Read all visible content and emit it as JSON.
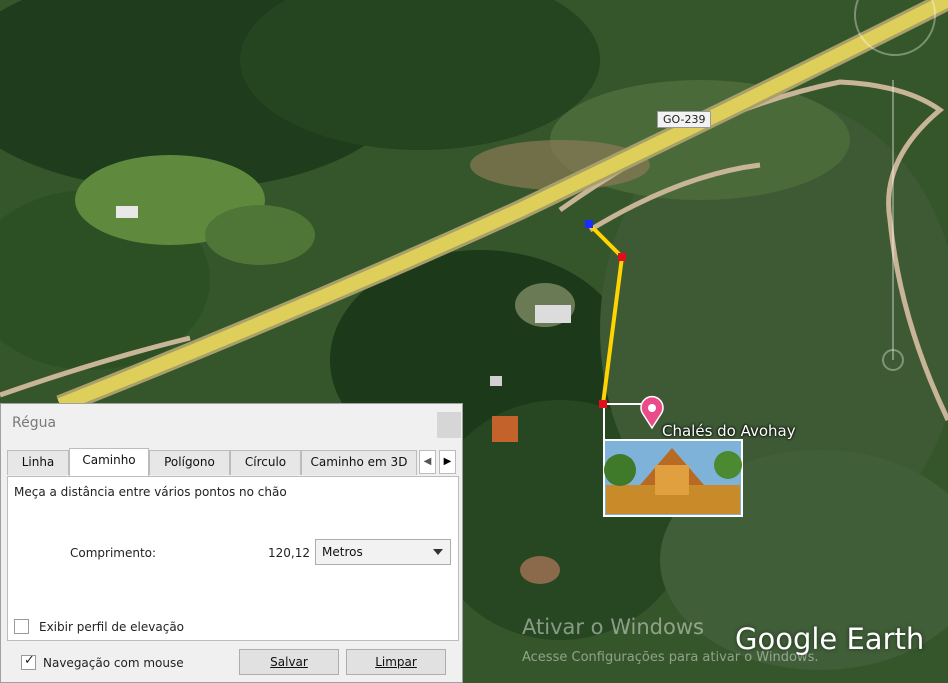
{
  "map": {
    "road_label": "GO-239",
    "place_label": "Chalés do Avohay",
    "watermark_title": "Ativar o Windows",
    "watermark_subtitle": "Acesse Configurações para ativar o Windows.",
    "brand": "Google Earth",
    "colors": {
      "road": "#e3d45a",
      "path_line": "#ffd400",
      "path_point": "#e0101a",
      "start_point": "#1a2cff",
      "pin": "#ea4c89"
    }
  },
  "ruler_dialog": {
    "title": "Régua",
    "tabs": [
      {
        "label": "Linha",
        "active": false
      },
      {
        "label": "Caminho",
        "active": true
      },
      {
        "label": "Polígono",
        "active": false
      },
      {
        "label": "Círculo",
        "active": false
      },
      {
        "label": "Caminho em 3D",
        "active": false
      }
    ],
    "description": "Meça a distância entre vários pontos no chão",
    "length_label": "Comprimento:",
    "length_value": "120,12",
    "unit": "Metros",
    "elevation_profile_label": "Exibir perfil de elevação",
    "elevation_profile_checked": false,
    "mouse_navigation_label": "Navegação com mouse",
    "mouse_navigation_checked": true,
    "save_label": "Salvar",
    "clear_label": "Limpar"
  }
}
